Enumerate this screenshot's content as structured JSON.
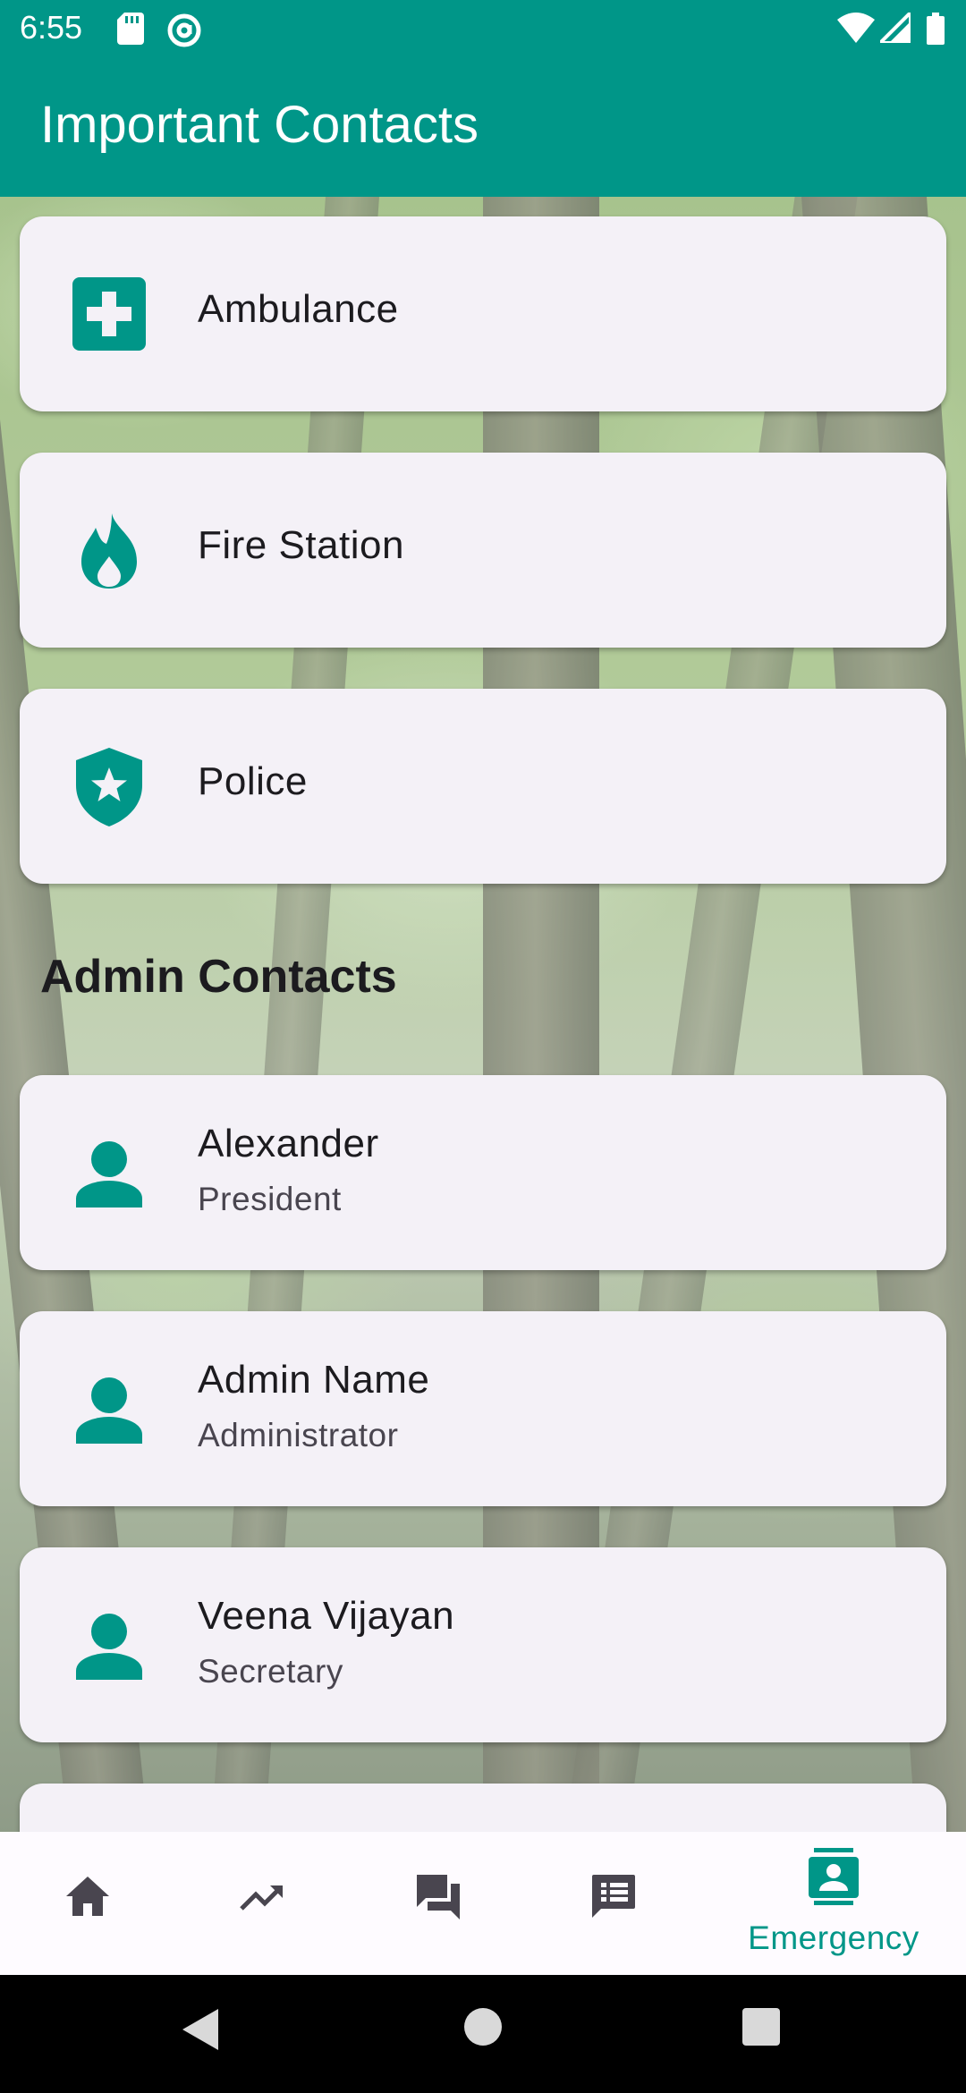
{
  "status_bar": {
    "time": "6:55",
    "icons": [
      "sd-card-icon",
      "at-sign-icon",
      "wifi-icon",
      "signal-icon",
      "battery-icon"
    ]
  },
  "app_bar": {
    "title": "Important Contacts"
  },
  "emergency_contacts": [
    {
      "label": "Ambulance",
      "icon": "medical-cross-icon"
    },
    {
      "label": "Fire Station",
      "icon": "fire-icon"
    },
    {
      "label": "Police",
      "icon": "shield-star-icon"
    }
  ],
  "admin_section": {
    "heading": "Admin Contacts",
    "contacts": [
      {
        "name": "Alexander",
        "role": "President",
        "icon": "person-icon"
      },
      {
        "name": "Admin Name",
        "role": "Administrator",
        "icon": "person-icon"
      },
      {
        "name": "Veena Vijayan",
        "role": "Secretary",
        "icon": "person-icon"
      }
    ]
  },
  "bottom_nav": {
    "items": [
      {
        "icon": "home-icon",
        "label": ""
      },
      {
        "icon": "trending-up-icon",
        "label": ""
      },
      {
        "icon": "forum-icon",
        "label": ""
      },
      {
        "icon": "article-icon",
        "label": ""
      },
      {
        "icon": "contact-card-icon",
        "label": "Emergency",
        "selected": true
      }
    ]
  },
  "colors": {
    "primary": "#009688",
    "card_bg": "#f4f1f7",
    "nav_inactive": "#49454f"
  }
}
